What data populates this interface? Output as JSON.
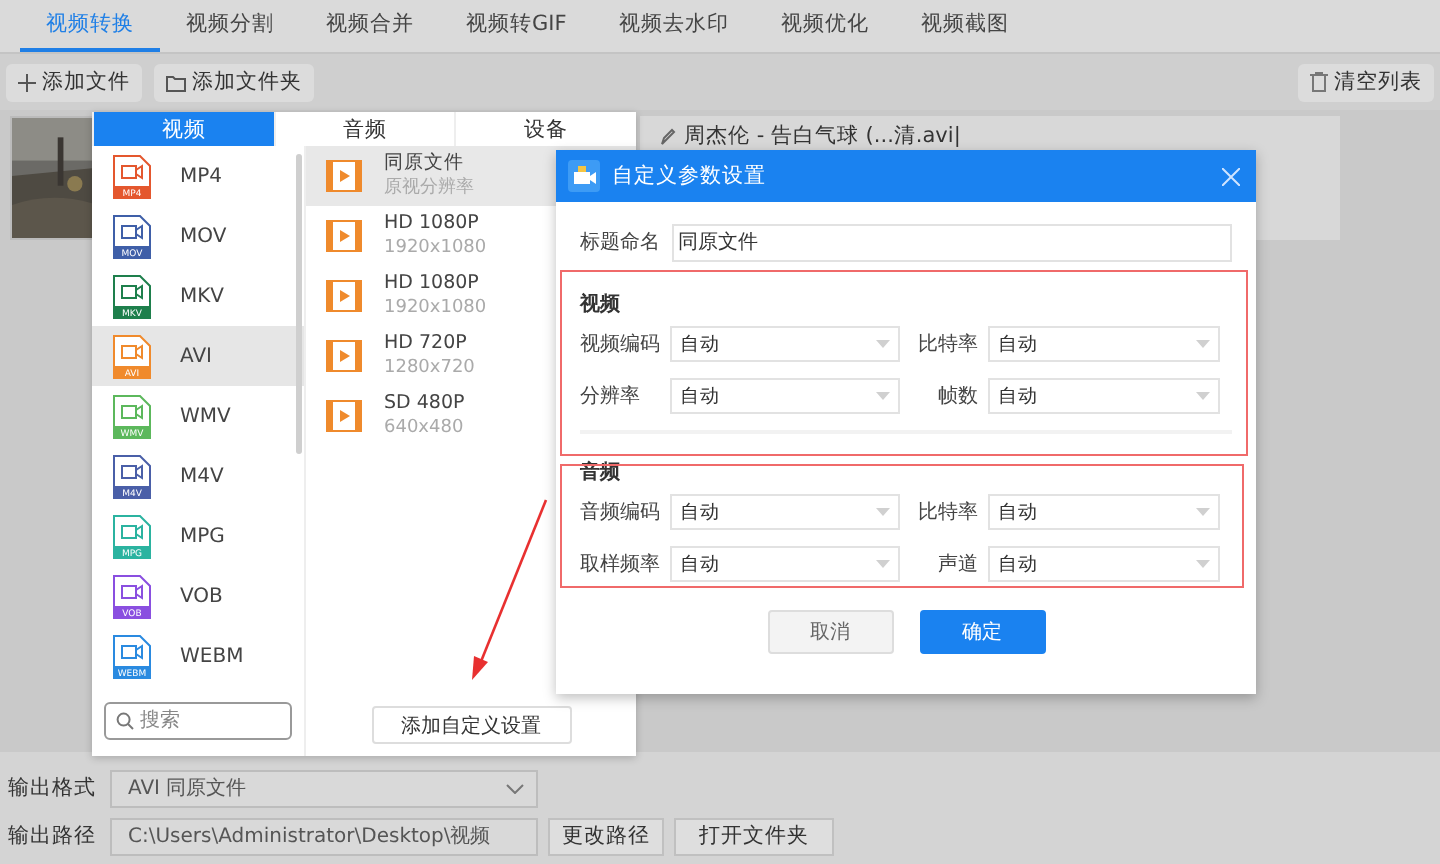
{
  "top_tabs": [
    {
      "label": "视频转换",
      "selected": true
    },
    {
      "label": "视频分割",
      "selected": false
    },
    {
      "label": "视频合并",
      "selected": false
    },
    {
      "label": "视频转GIF",
      "selected": false
    },
    {
      "label": "视频去水印",
      "selected": false
    },
    {
      "label": "视频优化",
      "selected": false
    },
    {
      "label": "视频截图",
      "selected": false
    }
  ],
  "toolbar": {
    "add_file": "添加文件",
    "add_folder": "添加文件夹",
    "clear": "清空列表"
  },
  "file": {
    "name": "周杰伦 - 告白气球 (...清.avi|"
  },
  "format_popup": {
    "tabs": [
      {
        "label": "视频",
        "selected": true
      },
      {
        "label": "音频",
        "selected": false
      },
      {
        "label": "设备",
        "selected": false
      }
    ],
    "formats": [
      {
        "label": "MP4",
        "badge": "MP4",
        "color": "#e4572e",
        "selected": false
      },
      {
        "label": "MOV",
        "badge": "MOV",
        "color": "#3f5fa8",
        "selected": false
      },
      {
        "label": "MKV",
        "badge": "MKV",
        "color": "#1e7f4c",
        "selected": false
      },
      {
        "label": "AVI",
        "badge": "AVI",
        "color": "#f08a2c",
        "selected": true
      },
      {
        "label": "WMV",
        "badge": "WMV",
        "color": "#5cb85c",
        "selected": false
      },
      {
        "label": "M4V",
        "badge": "M4V",
        "color": "#4a5fa8",
        "selected": false
      },
      {
        "label": "MPG",
        "badge": "MPG",
        "color": "#2bb3a0",
        "selected": false
      },
      {
        "label": "VOB",
        "badge": "VOB",
        "color": "#8a4fe0",
        "selected": false
      },
      {
        "label": "WEBM",
        "badge": "WEBM",
        "color": "#2a8ae0",
        "selected": false
      }
    ],
    "presets": [
      {
        "title": "同原文件",
        "detail": "原视分辨率",
        "selected": true
      },
      {
        "title": "HD 1080P",
        "detail": "1920x1080",
        "selected": false
      },
      {
        "title": "HD 1080P",
        "detail": "1920x1080",
        "selected": false
      },
      {
        "title": "HD 720P",
        "detail": "1280x720",
        "selected": false
      },
      {
        "title": "SD 480P",
        "detail": "640x480",
        "selected": false
      }
    ],
    "search": {
      "placeholder": "搜索"
    },
    "add_button": "添加自定义设置"
  },
  "dialog": {
    "title": "自定义参数设置",
    "title_field": {
      "label": "标题命名",
      "value": "同原文件"
    },
    "sections": [
      {
        "heading": "视频",
        "fields": [
          {
            "label": "视频编码",
            "value": "自动"
          },
          {
            "label": "比特率",
            "value": "自动"
          },
          {
            "label": "分辨率",
            "value": "自动"
          },
          {
            "label": "帧数",
            "value": "自动"
          }
        ]
      },
      {
        "heading": "音频",
        "fields": [
          {
            "label": "音频编码",
            "value": "自动"
          },
          {
            "label": "比特率",
            "value": "自动"
          },
          {
            "label": "取样频率",
            "value": "自动"
          },
          {
            "label": "声道",
            "value": "自动"
          }
        ]
      }
    ],
    "buttons": [
      {
        "label": "取消",
        "kind": "secondary"
      },
      {
        "label": "确定",
        "kind": "primary"
      }
    ]
  },
  "output": {
    "format_label": "输出格式",
    "format_value": "AVI  同原文件",
    "path_label": "输出路径",
    "path_value": "C:\\Users\\Administrator\\Desktop\\视频",
    "change_path": "更改路径",
    "open_folder": "打开文件夹"
  },
  "annotations": [
    {
      "kind": "box"
    },
    {
      "kind": "box"
    },
    {
      "kind": "arrow"
    }
  ]
}
